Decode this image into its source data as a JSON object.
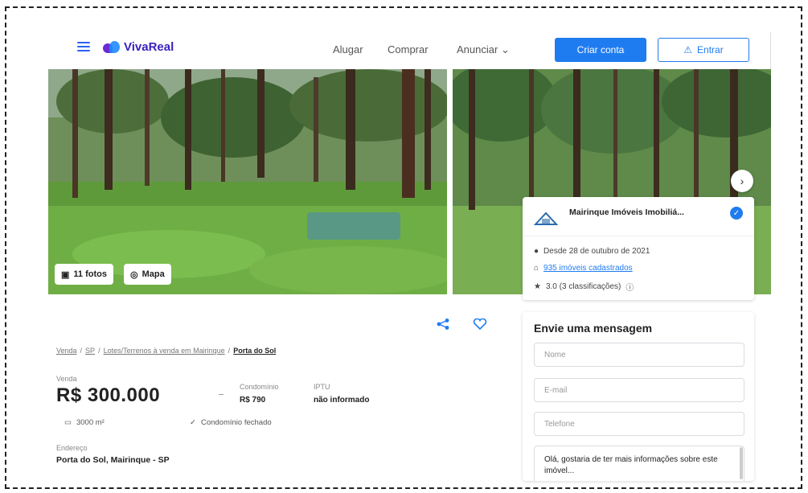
{
  "header": {
    "brand": "VivaReal",
    "nav": [
      "Alugar",
      "Comprar",
      "Anunciar"
    ],
    "create_account": "Criar conta",
    "login": "Entrar"
  },
  "gallery": {
    "photos_button": "11 fotos",
    "map_button": "Mapa"
  },
  "advertiser": {
    "name": "Mairinque Imóveis Imobiliá...",
    "since": "Desde 28 de outubro de 2021",
    "properties": "935 imóveis cadastrados",
    "rating": "3.0 (3 classificações)"
  },
  "listing": {
    "breadcrumb": [
      "Venda",
      "SP",
      "Lotes/Terrenos à venda em Mairinque",
      "Porta do Sol"
    ],
    "sale_label": "Venda",
    "price": "R$ 300.000",
    "condo_label": "Condomínio",
    "condo_value": "R$ 790",
    "iptu_label": "IPTU",
    "iptu_value": "não informado",
    "area": "3000 m²",
    "condo_feature": "Condomínio fechado",
    "address_label": "Endereço",
    "address_value": "Porta do Sol, Mairinque - SP"
  },
  "contact": {
    "title": "Envie uma mensagem",
    "name_placeholder": "Nome",
    "email_placeholder": "E-mail",
    "phone_placeholder": "Telefone",
    "message": "Olá, gostaria de ter mais informações sobre este imóvel..."
  },
  "colors": {
    "primary": "#1f7cf0",
    "brand": "#3a1fbf"
  }
}
